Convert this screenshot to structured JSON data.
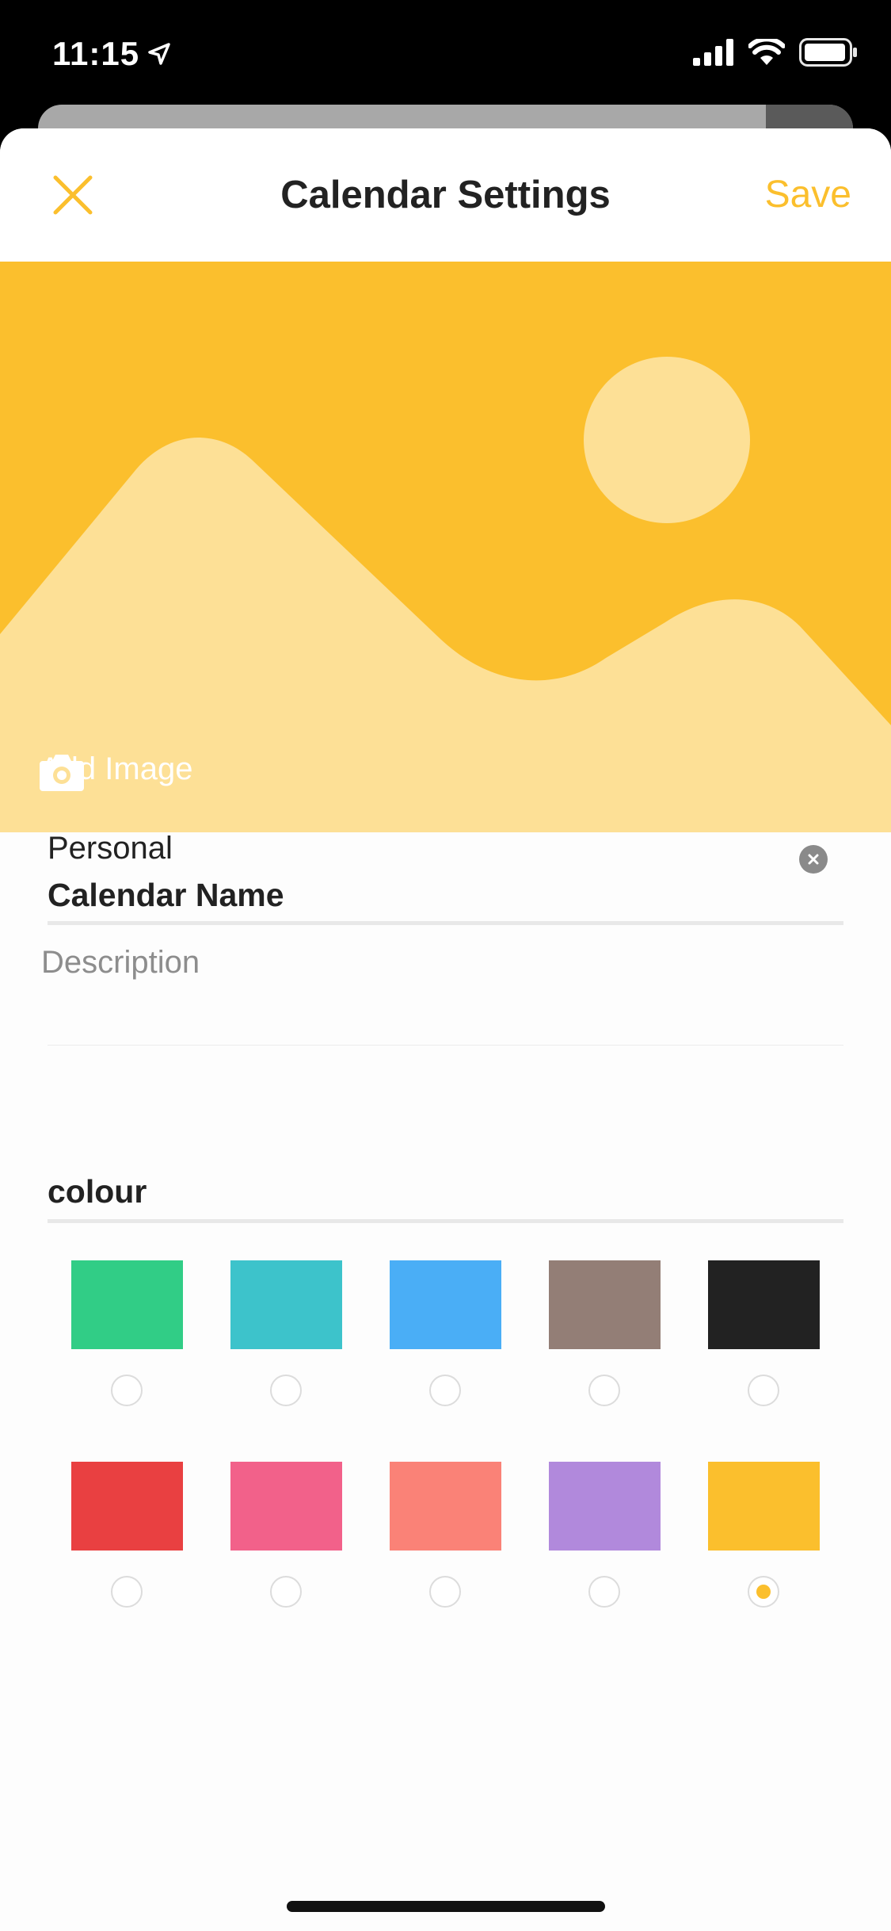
{
  "status_bar": {
    "time": "11:15"
  },
  "nav": {
    "title": "Calendar Settings",
    "save_label": "Save",
    "close_icon": "close-icon"
  },
  "hero": {
    "add_image_label": "Add Image",
    "camera_icon": "camera-icon"
  },
  "form": {
    "name_label": "Calendar Name",
    "name_value": "Personal",
    "description_placeholder": "Description",
    "colour_label": "colour"
  },
  "colours": {
    "selected": "#fbbf2d",
    "options": [
      "#31cd86",
      "#3dc3cb",
      "#4aaef6",
      "#937e76",
      "#222222",
      "#e94041",
      "#f2618a",
      "#fa8277",
      "#b189dc",
      "#fbbf2d"
    ]
  },
  "theme": {
    "accent": "#fbbf2d",
    "hero_light": "#fde096"
  }
}
